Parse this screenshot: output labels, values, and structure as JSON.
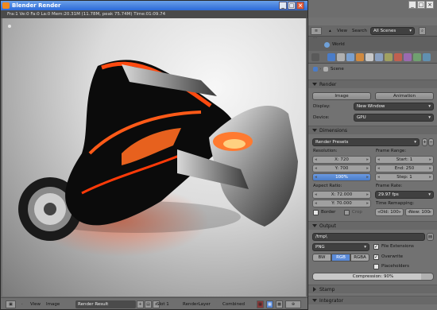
{
  "render_window": {
    "title": "Blender Render",
    "info": "Fra:1  Ve:0 Fa:0 La:0 Mem:20.31M (11.78M, peak 75.74M) Time:01:09.74",
    "footer": {
      "view_label": "View",
      "image_label": "Image",
      "image_name": "Render Result",
      "slot": "Slot 1",
      "layer": "RenderLayer",
      "pass": "Combined"
    }
  },
  "properties": {
    "outliner": {
      "view_label": "View",
      "search_label": "Search",
      "scenes_dropdown": "All Scenes",
      "world_item": "World"
    },
    "breadcrumb": "Scene",
    "render": {
      "header": "Render",
      "image_button": "Image",
      "animation_button": "Animation",
      "display_label": "Display:",
      "display_value": "New Window",
      "device_label": "Device:",
      "device_value": "GPU"
    },
    "dimensions": {
      "header": "Dimensions",
      "presets": "Render Presets",
      "resolution_label": "Resolution:",
      "res_x": "X: 720",
      "res_y": "Y: 700",
      "res_pct": "100%",
      "frame_range_label": "Frame Range:",
      "start": "Start: 1",
      "end": "End: 250",
      "step": "Step: 1",
      "aspect_label": "Aspect Ratio:",
      "aspect_x": "X: 72.000",
      "aspect_y": "Y: 70.000",
      "frame_rate_label": "Frame Rate:",
      "fps": "29.97 fps",
      "time_remap_label": "Time Remapping:",
      "old": "Old: 100",
      "new": "New: 100",
      "border_label": "Border",
      "crop_label": "Crop"
    },
    "output": {
      "header": "Output",
      "path": "/tmp\\",
      "format": "PNG",
      "file_ext_label": "File Extensions",
      "overwrite_label": "Overwrite",
      "placeholders_label": "Placeholders",
      "bw": "BW",
      "rgb": "RGB",
      "rgba": "RGBA",
      "compression": "Compression: 90%",
      "compression_fraction": 0.9
    },
    "stamp": {
      "header": "Stamp"
    },
    "integrator": {
      "header": "Integrator"
    }
  },
  "colors": {
    "title_bar": "#2c6ad8",
    "accent_blue": "#5a8ad8",
    "bike_orange": "#ff4a10"
  }
}
